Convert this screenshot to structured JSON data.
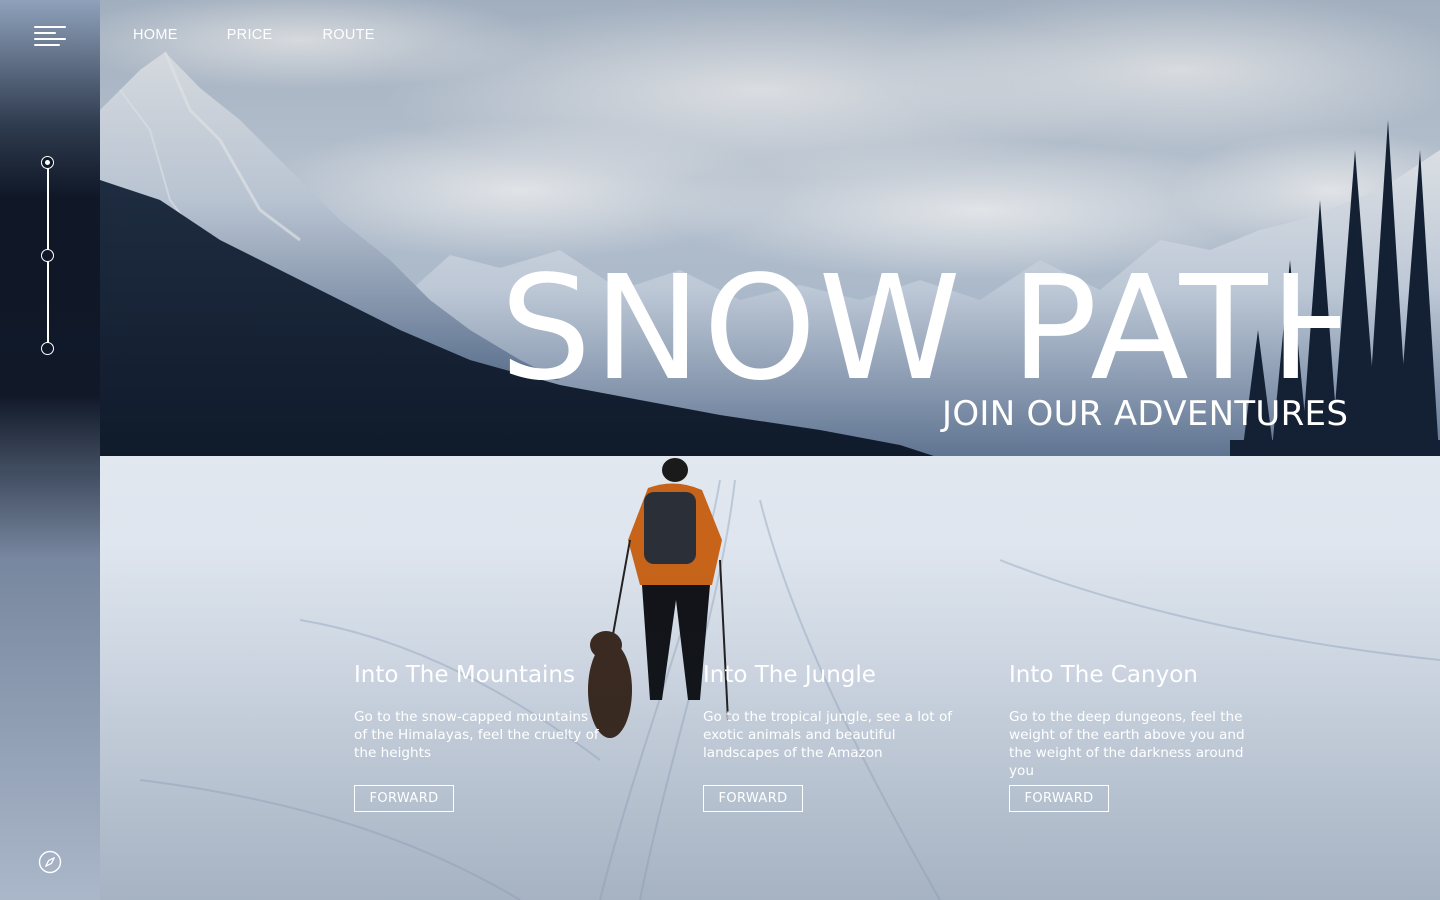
{
  "nav": {
    "links": [
      "HOME",
      "PRICE",
      "ROUTE"
    ]
  },
  "hero": {
    "title": "SNOW PATH",
    "subtitle": "JOIN OUR ADVENTURES"
  },
  "cards": [
    {
      "title": "Into The Mountains",
      "description": "Go to the snow-capped mountains of the Himalayas, feel the cruelty of the heights",
      "button": "FORWARD"
    },
    {
      "title": "Into The Jungle",
      "description": "Go to the tropical jungle, see a lot of exotic animals and beautiful landscapes of the Amazon",
      "button": "FORWARD"
    },
    {
      "title": "Into The Canyon",
      "description": "Go to the deep dungeons, feel the weight of the earth above you and the weight of the darkness around you",
      "button": "FORWARD"
    }
  ],
  "sidebar": {
    "menu_icon": "hamburger-menu-icon",
    "slide_dots": 3,
    "active_slide": 1,
    "bottom_icon": "compass-icon"
  },
  "colors": {
    "text": "#ffffff",
    "sidebar_dark": "#0f1828",
    "sky": "#b7c6d8",
    "snow": "#dfe6ef"
  }
}
